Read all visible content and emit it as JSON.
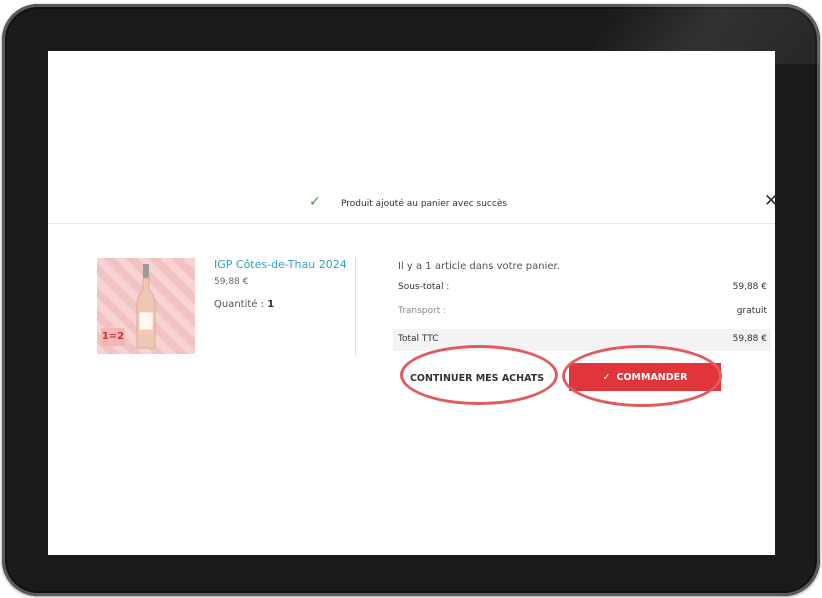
{
  "notice": {
    "text": "Produit ajouté au panier avec succès"
  },
  "product": {
    "name": "IGP Côtes-de-Thau 2024",
    "price": "59,88 €",
    "quantity_label": "Quantité :",
    "quantity_value": "1",
    "promo_badge": "1=2"
  },
  "summary": {
    "title": "Il y a 1 article dans votre panier.",
    "subtotal_label": "Sous-total :",
    "subtotal_value": "59,88 €",
    "transport_label": "Transport :",
    "transport_value": "gratuit",
    "total_label": "Total TTC",
    "total_value": "59,88 €"
  },
  "buttons": {
    "continue_label": "CONTINUER MES ACHATS",
    "order_label": "COMMANDER"
  },
  "colors": {
    "accent": "#e0353a",
    "link": "#2aa3c9",
    "highlight_ring": "#e25a5f"
  },
  "icons": {
    "success": "check-icon",
    "close": "close-icon",
    "order": "check-icon"
  }
}
